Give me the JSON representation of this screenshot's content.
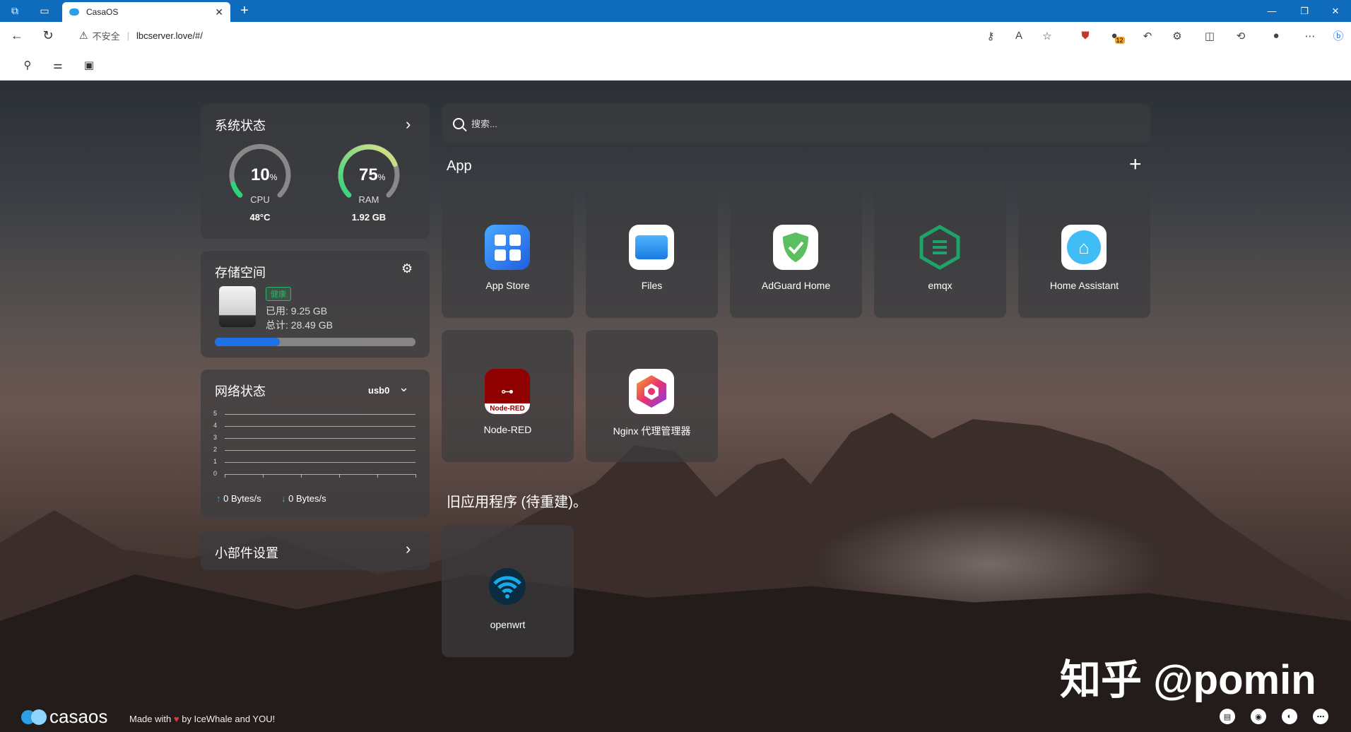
{
  "browser": {
    "tab_title": "CasaOS",
    "new_tab_label": "+",
    "tab_close_label": "✕",
    "insecure_label": "不安全",
    "url": "lbcserver.love/#/",
    "extension_count": "12"
  },
  "system": {
    "title": "系统状态",
    "cpu": {
      "value": "10",
      "unit": "%",
      "label": "CPU",
      "sub": "48°C",
      "percent": 10,
      "color": "#2ed47a"
    },
    "ram": {
      "value": "75",
      "unit": "%",
      "label": "RAM",
      "sub": "1.92 GB",
      "percent": 75,
      "color": "#2ed47a"
    }
  },
  "storage": {
    "title": "存储空间",
    "health": "健康",
    "used": "已用: 9.25 GB",
    "total": "总计: 28.49 GB",
    "used_fraction": 0.325
  },
  "network": {
    "title": "网络状态",
    "interface": "usb0",
    "y_ticks": [
      "5",
      "4",
      "3",
      "2",
      "1",
      "0"
    ],
    "up": "0 Bytes/s",
    "down": "0 Bytes/s"
  },
  "widgets": {
    "label": "小部件设置"
  },
  "search": {
    "placeholder": "搜索..."
  },
  "apps_section": {
    "title": "App"
  },
  "apps": [
    {
      "name": "App Store"
    },
    {
      "name": "Files"
    },
    {
      "name": "AdGuard Home"
    },
    {
      "name": "emqx"
    },
    {
      "name": "Home Assistant"
    },
    {
      "name": "Node-RED",
      "icon_text": "Node-RED"
    },
    {
      "name": "Nginx 代理管理器"
    }
  ],
  "legacy_section": {
    "title": "旧应用程序 (待重建)。"
  },
  "legacy_apps": [
    {
      "name": "openwrt"
    }
  ],
  "footer": {
    "logo": "casaos",
    "made_with": "Made with",
    "by": "by IceWhale and YOU!"
  },
  "watermark": "知乎 @pomin",
  "colors": {
    "accent": "#1e72e6",
    "chrome": "#0f6cbd",
    "health": "#2db36b"
  }
}
